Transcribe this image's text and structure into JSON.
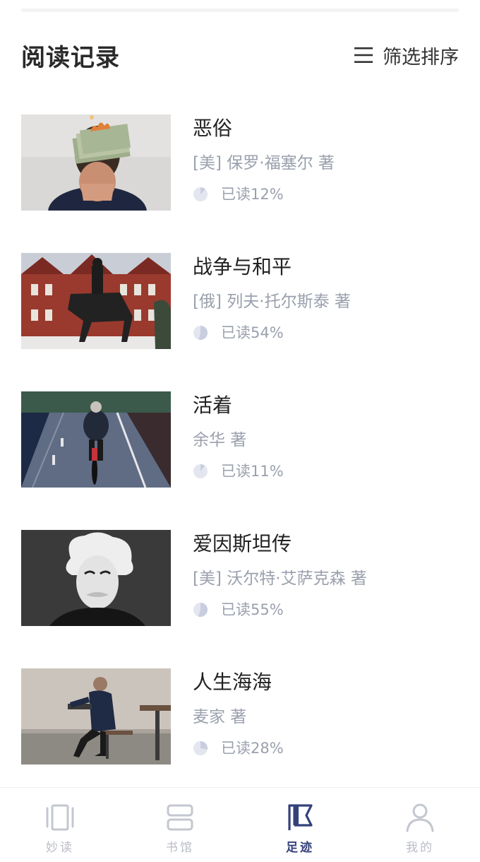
{
  "header": {
    "title": "阅读记录",
    "filter_label": "筛选排序"
  },
  "books": [
    {
      "title": "恶俗",
      "author": "[美] 保罗·福塞尔 著",
      "progress_text": "已读12%",
      "progress": 0.12,
      "cover": "money-hands-cover"
    },
    {
      "title": "战争与和平",
      "author": "[俄] 列夫·托尔斯泰 著",
      "progress_text": "已读54%",
      "progress": 0.54,
      "cover": "statue-building-cover"
    },
    {
      "title": "活着",
      "author": "余华 著",
      "progress_text": "已读11%",
      "progress": 0.11,
      "cover": "cyclist-road-cover"
    },
    {
      "title": "爱因斯坦传",
      "author": "[美] 沃尔特·艾萨克森 著",
      "progress_text": "已读55%",
      "progress": 0.55,
      "cover": "einstein-portrait-cover"
    },
    {
      "title": "人生海海",
      "author": "麦家 著",
      "progress_text": "已读28%",
      "progress": 0.28,
      "cover": "old-man-bench-cover"
    }
  ],
  "tabbar": {
    "items": [
      {
        "label": "妙读",
        "icon": "read-icon",
        "active": false
      },
      {
        "label": "书馆",
        "icon": "library-icon",
        "active": false
      },
      {
        "label": "足迹",
        "icon": "flag-icon",
        "active": true
      },
      {
        "label": "我的",
        "icon": "user-icon",
        "active": false
      }
    ]
  },
  "colors": {
    "accent": "#34417a",
    "muted": "#9aa0ad",
    "inactive_tab": "#b9bdc6",
    "progress_fill": "#c9cde0",
    "progress_track": "#e4e6ef"
  }
}
